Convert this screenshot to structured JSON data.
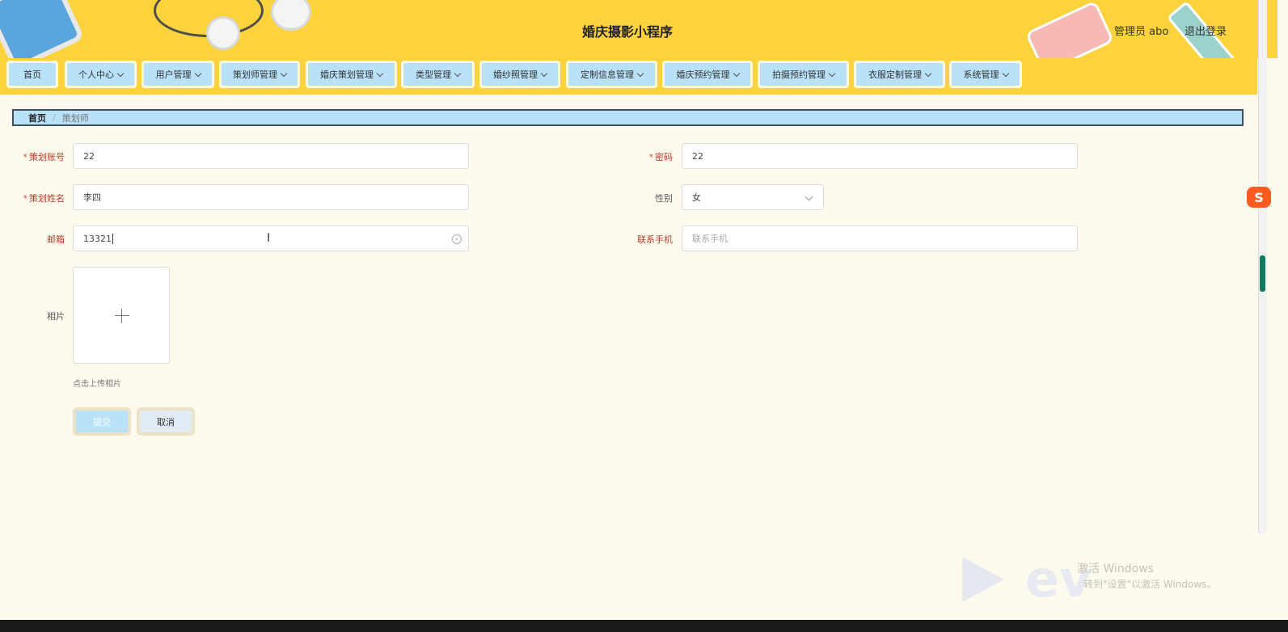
{
  "header": {
    "title": "婚庆摄影小程序",
    "user_info": "管理员 abo",
    "logout_label": "退出登录"
  },
  "nav": {
    "items": [
      {
        "label": "首页"
      },
      {
        "label": "个人中心"
      },
      {
        "label": "用户管理"
      },
      {
        "label": "策划师管理"
      },
      {
        "label": "婚庆策划管理"
      },
      {
        "label": "类型管理"
      },
      {
        "label": "婚纱照管理"
      },
      {
        "label": "定制信息管理"
      },
      {
        "label": "婚庆预约管理"
      },
      {
        "label": "拍摄预约管理"
      },
      {
        "label": "衣服定制管理"
      },
      {
        "label": "系统管理"
      }
    ]
  },
  "breadcrumb": {
    "home": "首页",
    "separator": "/",
    "current": "策划师"
  },
  "form": {
    "account": {
      "label": "策划账号",
      "value": "22"
    },
    "password": {
      "label": "密码",
      "value": "22"
    },
    "name": {
      "label": "策划姓名",
      "value": "李四"
    },
    "gender": {
      "label": "性别",
      "value": "女"
    },
    "email": {
      "label": "邮箱",
      "value": "13321"
    },
    "phone": {
      "label": "联系手机",
      "value": "",
      "placeholder": "联系手机"
    },
    "photo": {
      "label": "相片",
      "hint": "点击上传相片"
    },
    "required_mark": "*"
  },
  "buttons": {
    "submit": "提交",
    "cancel": "取消"
  },
  "colors": {
    "header_bg": "#fcd23d",
    "nav_item_bg": "#b9e2f9",
    "page_bg": "#fefaee",
    "required": "#c0392b"
  },
  "icons": {
    "clear": "circle-close-icon",
    "select": "chevron-down-icon",
    "upload": "plus-icon"
  }
}
